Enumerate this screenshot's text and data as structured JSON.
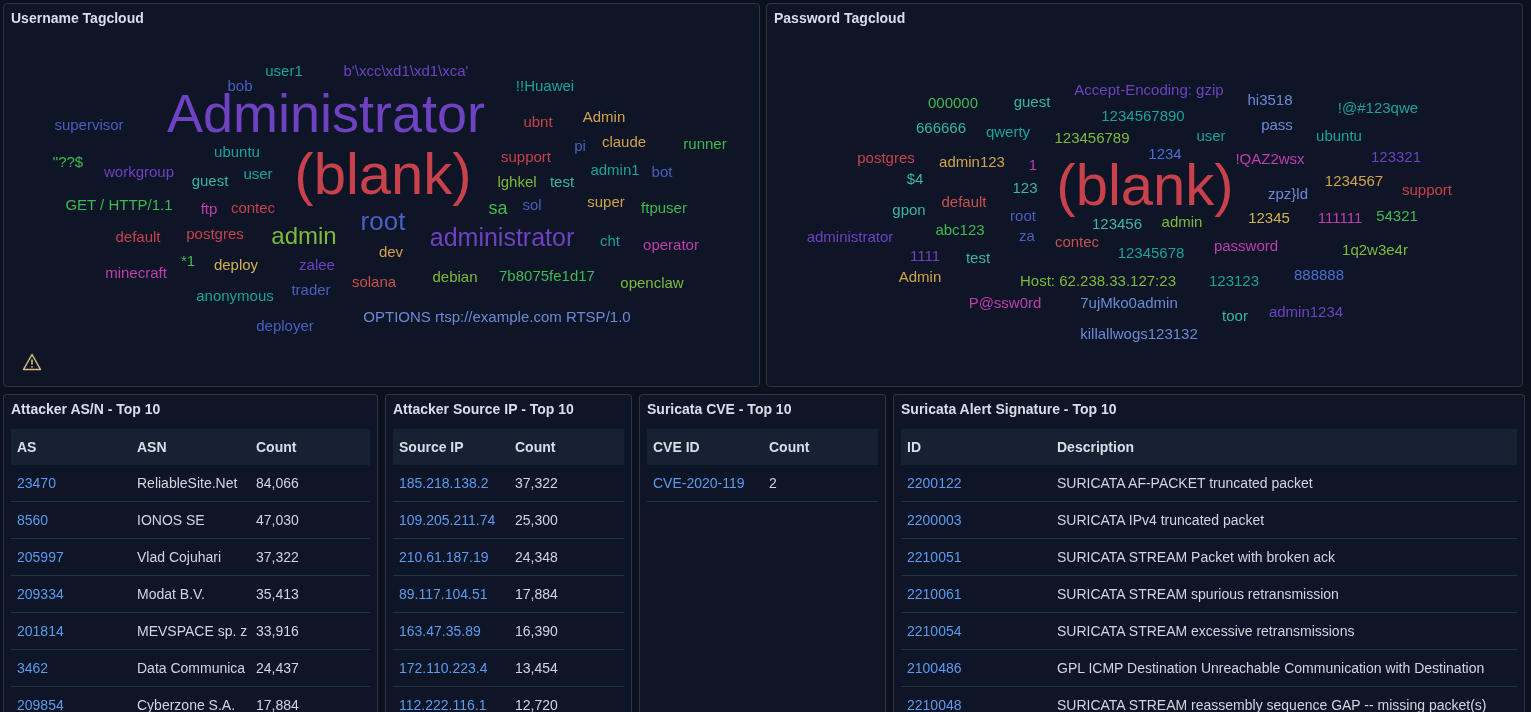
{
  "username_tagcloud": {
    "title": "Username Tagcloud",
    "words": [
      {
        "text": "bob",
        "color": "#4a5fc1"
      },
      {
        "text": "user1",
        "color": "#1aa39a"
      },
      {
        "text": "b'\\xcc\\xd1\\xd1\\xca'",
        "color": "#6f42c1"
      },
      {
        "text": "!!Huawei",
        "color": "#1aa39a"
      },
      {
        "text": "supervisor",
        "color": "#4a5fc1"
      },
      {
        "text": "Administrator",
        "color": "#6f42c1"
      },
      {
        "text": "ubnt",
        "color": "#c8414b"
      },
      {
        "text": "Admin",
        "color": "#d4a24c"
      },
      {
        "text": "\"??$",
        "color": "#3fb950"
      },
      {
        "text": "workgroup",
        "color": "#6f42c1"
      },
      {
        "text": "ubuntu",
        "color": "#1aa39a"
      },
      {
        "text": "guest",
        "color": "#3ab5a8"
      },
      {
        "text": "user",
        "color": "#1aa39a"
      },
      {
        "text": "GET / HTTP/1.1",
        "color": "#3fb950"
      },
      {
        "text": "ftp",
        "color": "#c23cb0"
      },
      {
        "text": "contec",
        "color": "#c8414b"
      },
      {
        "text": "(blank)",
        "color": "#c8414b"
      },
      {
        "text": "pi",
        "color": "#4a5fc1"
      },
      {
        "text": "claude",
        "color": "#d4a24c"
      },
      {
        "text": "runner",
        "color": "#3fb950"
      },
      {
        "text": "support",
        "color": "#c8414b"
      },
      {
        "text": "admin1",
        "color": "#1aa39a"
      },
      {
        "text": "bot",
        "color": "#4a5fc1"
      },
      {
        "text": "lghkel",
        "color": "#7fba3c"
      },
      {
        "text": "test",
        "color": "#3ab5a8"
      },
      {
        "text": "default",
        "color": "#c8414b"
      },
      {
        "text": "postgres",
        "color": "#c8414b"
      },
      {
        "text": "admin",
        "color": "#7fba3c"
      },
      {
        "text": "root",
        "color": "#4a5fc1"
      },
      {
        "text": "sa",
        "color": "#3fb950"
      },
      {
        "text": "sol",
        "color": "#4a5fc1"
      },
      {
        "text": "super",
        "color": "#d4a24c"
      },
      {
        "text": "ftpuser",
        "color": "#3fb950"
      },
      {
        "text": "minecraft",
        "color": "#c23cb0"
      },
      {
        "text": "*1",
        "color": "#3fb950"
      },
      {
        "text": "deploy",
        "color": "#d4b24c"
      },
      {
        "text": "zalee",
        "color": "#6f42c1"
      },
      {
        "text": "dev",
        "color": "#d4a24c"
      },
      {
        "text": "administrator",
        "color": "#6f42c1"
      },
      {
        "text": "cht",
        "color": "#1aa39a"
      },
      {
        "text": "operator",
        "color": "#c23cb0"
      },
      {
        "text": "anonymous",
        "color": "#1aa39a"
      },
      {
        "text": "trader",
        "color": "#4a5fc1"
      },
      {
        "text": "solana",
        "color": "#c8514b"
      },
      {
        "text": "debian",
        "color": "#7fba3c"
      },
      {
        "text": "7b8075fe1d17",
        "color": "#3fb950"
      },
      {
        "text": "openclaw",
        "color": "#7fba3c"
      },
      {
        "text": "deployer",
        "color": "#4a5fc1"
      },
      {
        "text": "OPTIONS rtsp://example.com RTSP/1.0",
        "color": "#6b8ad6"
      }
    ]
  },
  "password_tagcloud": {
    "title": "Password Tagcloud",
    "words": [
      {
        "text": "000000",
        "color": "#3fb950"
      },
      {
        "text": "guest",
        "color": "#3ab5a8"
      },
      {
        "text": "Accept-Encoding: gzip",
        "color": "#6f42c1"
      },
      {
        "text": "666666",
        "color": "#3ab5a8"
      },
      {
        "text": "qwerty",
        "color": "#1aa39a"
      },
      {
        "text": "1234567890",
        "color": "#1aa39a"
      },
      {
        "text": "hi3518",
        "color": "#6b8ad6"
      },
      {
        "text": "!@#123qwe",
        "color": "#1aa39a"
      },
      {
        "text": "123456789",
        "color": "#7fba3c"
      },
      {
        "text": "user",
        "color": "#1aa39a"
      },
      {
        "text": "pass",
        "color": "#6b8ad6"
      },
      {
        "text": "ubuntu",
        "color": "#1aa39a"
      },
      {
        "text": "postgres",
        "color": "#c8414b"
      },
      {
        "text": "$4",
        "color": "#3ab5a8"
      },
      {
        "text": "admin123",
        "color": "#d4a24c"
      },
      {
        "text": "1",
        "color": "#c23cb0"
      },
      {
        "text": "1234",
        "color": "#4a6fd1"
      },
      {
        "text": "gpon",
        "color": "#3ab5a8"
      },
      {
        "text": "default",
        "color": "#c8514b"
      },
      {
        "text": "123",
        "color": "#3ab5a8"
      },
      {
        "text": "administrator",
        "color": "#6f42c1"
      },
      {
        "text": "abc123",
        "color": "#3fb950"
      },
      {
        "text": "root",
        "color": "#4a5fc1"
      },
      {
        "text": "za",
        "color": "#4a5fc1"
      },
      {
        "text": "(blank)",
        "color": "#c8414b"
      },
      {
        "text": "!QAZ2wsx",
        "color": "#c23cb0"
      },
      {
        "text": "123321",
        "color": "#6f42c1"
      },
      {
        "text": "zpz}ld",
        "color": "#6b8ad6"
      },
      {
        "text": "1234567",
        "color": "#d4a24c"
      },
      {
        "text": "support",
        "color": "#c8414b"
      },
      {
        "text": "123456",
        "color": "#3ab5a8"
      },
      {
        "text": "admin",
        "color": "#7fba3c"
      },
      {
        "text": "12345",
        "color": "#d4b24c"
      },
      {
        "text": "111111",
        "color": "#c23cb0"
      },
      {
        "text": "54321",
        "color": "#3fb950"
      },
      {
        "text": "1111",
        "color": "#6f42c1"
      },
      {
        "text": "test",
        "color": "#3ab5a8"
      },
      {
        "text": "contec",
        "color": "#c8514b"
      },
      {
        "text": "12345678",
        "color": "#1aa39a"
      },
      {
        "text": "password",
        "color": "#c23cb0"
      },
      {
        "text": "1q2w3e4r",
        "color": "#7fba3c"
      },
      {
        "text": "Admin",
        "color": "#d4a24c"
      },
      {
        "text": "Host: 62.238.33.127:23",
        "color": "#7fba3c"
      },
      {
        "text": "123123",
        "color": "#1aa39a"
      },
      {
        "text": "888888",
        "color": "#4a6fd1"
      },
      {
        "text": "P@ssw0rd",
        "color": "#c23cb0"
      },
      {
        "text": "7ujMko0admin",
        "color": "#6b8ad6"
      },
      {
        "text": "toor",
        "color": "#3ab5a8"
      },
      {
        "text": "admin1234",
        "color": "#6f42c1"
      },
      {
        "text": "killallwogs123132",
        "color": "#6b8ad6"
      }
    ]
  },
  "tables": [
    {
      "title": "Attacker AS/N - Top 10",
      "columns": [
        {
          "label": "AS",
          "kind": "link"
        },
        {
          "label": "ASN",
          "kind": "text"
        },
        {
          "label": "Count",
          "kind": "text"
        }
      ],
      "rows": [
        [
          "23470",
          "ReliableSite.Net",
          "84,066"
        ],
        [
          "8560",
          "IONOS SE",
          "47,030"
        ],
        [
          "205997",
          "Vlad Cojuhari",
          "37,322"
        ],
        [
          "209334",
          "Modat B.V.",
          "35,413"
        ],
        [
          "201814",
          "MEVSPACE sp. z",
          "33,916"
        ],
        [
          "3462",
          "Data Communica",
          "24,437"
        ],
        [
          "209854",
          "Cyberzone S.A.",
          "17,884"
        ]
      ]
    },
    {
      "title": "Attacker Source IP - Top 10",
      "columns": [
        {
          "label": "Source IP",
          "kind": "link"
        },
        {
          "label": "Count",
          "kind": "text"
        }
      ],
      "rows": [
        [
          "185.218.138.2",
          "37,322"
        ],
        [
          "109.205.211.74",
          "25,300"
        ],
        [
          "210.61.187.19",
          "24,348"
        ],
        [
          "89.117.104.51",
          "17,884"
        ],
        [
          "163.47.35.89",
          "16,390"
        ],
        [
          "172.110.223.4",
          "13,454"
        ],
        [
          "112.222.116.1",
          "12,720"
        ]
      ]
    },
    {
      "title": "Suricata CVE - Top 10",
      "columns": [
        {
          "label": "CVE ID",
          "kind": "link"
        },
        {
          "label": "Count",
          "kind": "text"
        }
      ],
      "rows": [
        [
          "CVE-2020-119",
          "2"
        ]
      ]
    },
    {
      "title": "Suricata Alert Signature - Top 10",
      "columns": [
        {
          "label": "ID",
          "kind": "link"
        },
        {
          "label": "Description",
          "kind": "text"
        }
      ],
      "rows": [
        [
          "2200122",
          "SURICATA AF-PACKET truncated packet"
        ],
        [
          "2200003",
          "SURICATA IPv4 truncated packet"
        ],
        [
          "2210051",
          "SURICATA STREAM Packet with broken ack"
        ],
        [
          "2210061",
          "SURICATA STREAM spurious retransmission"
        ],
        [
          "2210054",
          "SURICATA STREAM excessive retransmissions"
        ],
        [
          "2100486",
          "GPL ICMP Destination Unreachable Communication with Destination"
        ],
        [
          "2210048",
          "SURICATA STREAM reassembly sequence GAP -- missing packet(s)"
        ]
      ]
    }
  ]
}
